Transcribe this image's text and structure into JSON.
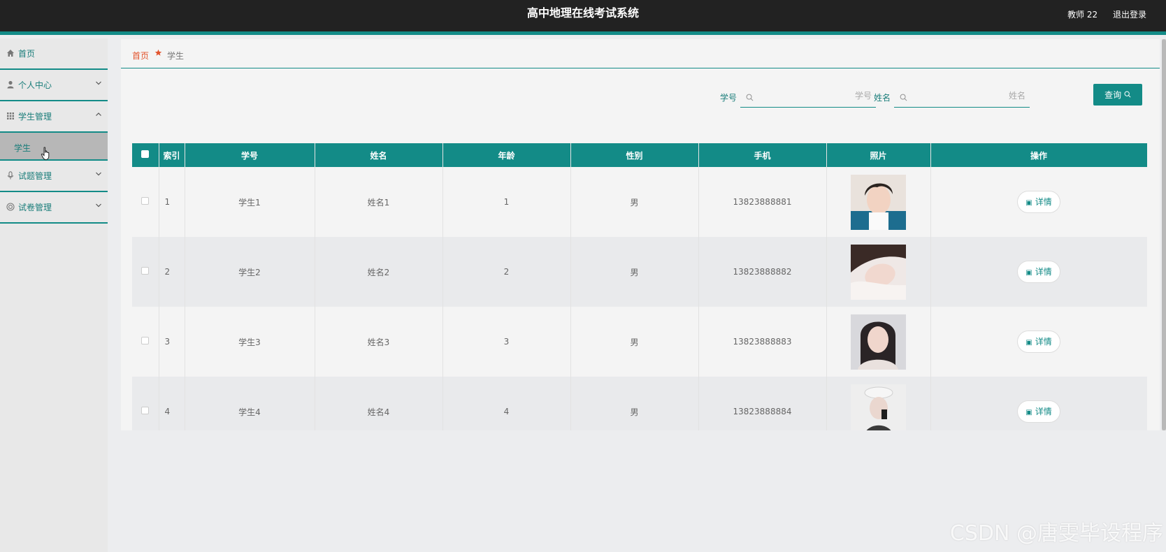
{
  "app_title": "高中地理在线考试系统",
  "header": {
    "user_label": "教师 22",
    "logout_label": "退出登录"
  },
  "sidebar": {
    "items": [
      {
        "label": "首页",
        "icon": "home-icon"
      },
      {
        "label": "个人中心",
        "icon": "user-icon"
      },
      {
        "label": "学生管理",
        "icon": "grid-icon",
        "sub": [
          {
            "label": "学生"
          }
        ]
      },
      {
        "label": "试题管理",
        "icon": "microphone-icon"
      },
      {
        "label": "试卷管理",
        "icon": "circle-icon"
      }
    ]
  },
  "breadcrumb": {
    "home": "首页",
    "current": "学生"
  },
  "search": {
    "id_label": "学号",
    "id_placeholder": "学号",
    "name_label": "姓名",
    "name_placeholder": "姓名",
    "button_label": "查询"
  },
  "table": {
    "columns": [
      "索引",
      "学号",
      "姓名",
      "年龄",
      "性别",
      "手机",
      "照片",
      "操作"
    ],
    "rows": [
      {
        "index": "1",
        "student_id": "学生1",
        "name": "姓名1",
        "age": "1",
        "gender": "男",
        "phone": "13823888881",
        "action": "详情"
      },
      {
        "index": "2",
        "student_id": "学生2",
        "name": "姓名2",
        "age": "2",
        "gender": "男",
        "phone": "13823888882",
        "action": "详情"
      },
      {
        "index": "3",
        "student_id": "学生3",
        "name": "姓名3",
        "age": "3",
        "gender": "男",
        "phone": "13823888883",
        "action": "详情"
      },
      {
        "index": "4",
        "student_id": "学生4",
        "name": "姓名4",
        "age": "4",
        "gender": "男",
        "phone": "13823888884",
        "action": "详情"
      }
    ]
  },
  "watermark": "CSDN @唐雯毕设程序",
  "colors": {
    "accent": "#138b87",
    "topbar": "#222222",
    "breadcrumb_home": "#e2542d"
  }
}
